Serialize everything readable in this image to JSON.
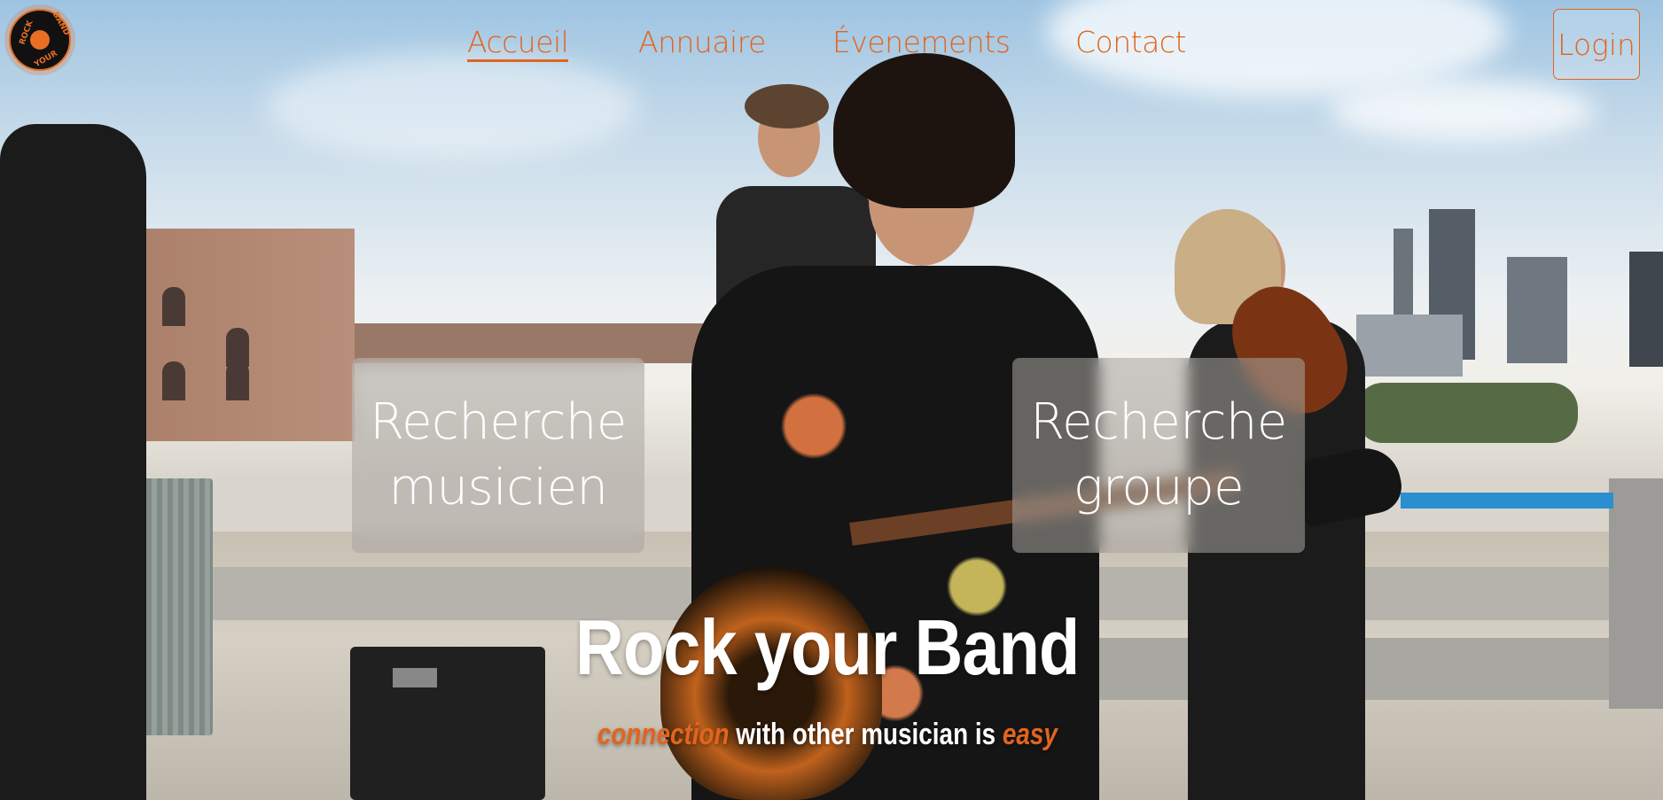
{
  "brand": {
    "logo_text_top": "ROCK",
    "logo_text_bottom": "YOUR",
    "logo_text_right": "BAND",
    "accent_color": "#e2641f"
  },
  "nav": {
    "items": [
      {
        "label": "Accueil",
        "active": true
      },
      {
        "label": "Annuaire",
        "active": false
      },
      {
        "label": "Évenements",
        "active": false
      },
      {
        "label": "Contact",
        "active": false
      }
    ],
    "login_label": "Login"
  },
  "cards": {
    "musician": {
      "line1": "Recherche",
      "line2": "musicien"
    },
    "group": {
      "line1": "Recherche",
      "line2": "groupe"
    }
  },
  "hero": {
    "title": "Rock your Band",
    "tagline_accent_1": "connection",
    "tagline_middle": "with other musician is",
    "tagline_accent_2": "easy"
  }
}
